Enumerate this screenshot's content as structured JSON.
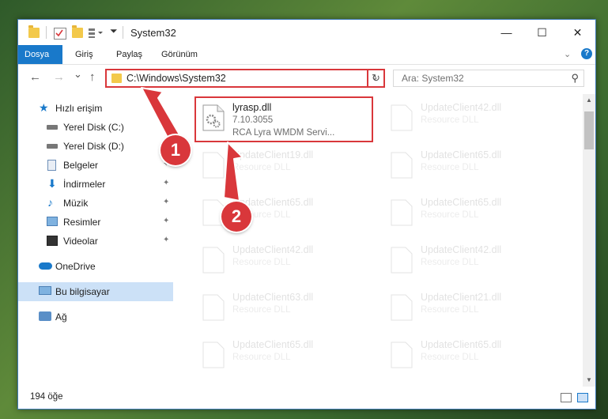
{
  "window": {
    "title": "System32",
    "controls": {
      "minimize": "—",
      "maximize": "☐",
      "close": "✕"
    }
  },
  "ribbon": {
    "tabs": [
      "Dosya",
      "Giriş",
      "Paylaş",
      "Görünüm"
    ],
    "expand_icon": "chevron-down-icon",
    "help": "?"
  },
  "nav": {
    "back": "←",
    "forward": "→",
    "recent": "⌄",
    "up": "↑",
    "address": "C:\\Windows\\System32",
    "address_dropdown": "⌄",
    "refresh": "↻",
    "search_placeholder": "Ara: System32",
    "search_icon": "⚲"
  },
  "sidebar": {
    "items": [
      {
        "label": "Hızlı erişim",
        "icon": "star-icon"
      },
      {
        "label": "Yerel Disk (C:)",
        "icon": "drive-icon"
      },
      {
        "label": "Yerel Disk (D:)",
        "icon": "drive-icon"
      },
      {
        "label": "Belgeler",
        "icon": "documents-icon"
      },
      {
        "label": "İndirmeler",
        "icon": "download-icon"
      },
      {
        "label": "Müzik",
        "icon": "music-icon"
      },
      {
        "label": "Resimler",
        "icon": "pictures-icon"
      },
      {
        "label": "Videolar",
        "icon": "video-icon"
      },
      {
        "label": "OneDrive",
        "icon": "cloud-icon"
      },
      {
        "label": "Bu bilgisayar",
        "icon": "computer-icon"
      },
      {
        "label": "Ağ",
        "icon": "network-icon"
      }
    ],
    "pin": "📌"
  },
  "files": {
    "main": {
      "name": "lyrasp.dll",
      "version": "7.10.3055",
      "description": "RCA Lyra WMDM Servi..."
    },
    "faded": [
      {
        "name": "UpdateClient42.dll",
        "desc": "Resource DLL"
      },
      {
        "name": "UpdateClient19.dll",
        "desc": "Resource DLL"
      },
      {
        "name": "UpdateClient65.dll",
        "desc": "Resource DLL"
      },
      {
        "name": "UpdateClient65.dll",
        "desc": "Resource DLL"
      },
      {
        "name": "UpdateClient65.dll",
        "desc": "Resource DLL"
      },
      {
        "name": "UpdateClient42.dll",
        "desc": "Resource DLL"
      },
      {
        "name": "UpdateClient42.dll",
        "desc": "Resource DLL"
      },
      {
        "name": "UpdateClient63.dll",
        "desc": "Resource DLL"
      },
      {
        "name": "UpdateClient21.dll",
        "desc": "Resource DLL"
      },
      {
        "name": "UpdateClient65.dll",
        "desc": "Resource DLL"
      },
      {
        "name": "UpdateClient65.dll",
        "desc": "Resource DLL"
      }
    ]
  },
  "status": {
    "count": "194 öğe"
  },
  "callouts": [
    "1",
    "2"
  ],
  "colors": {
    "accent": "#1979ca",
    "highlight": "#d9373b",
    "selection": "#cce1f7"
  }
}
